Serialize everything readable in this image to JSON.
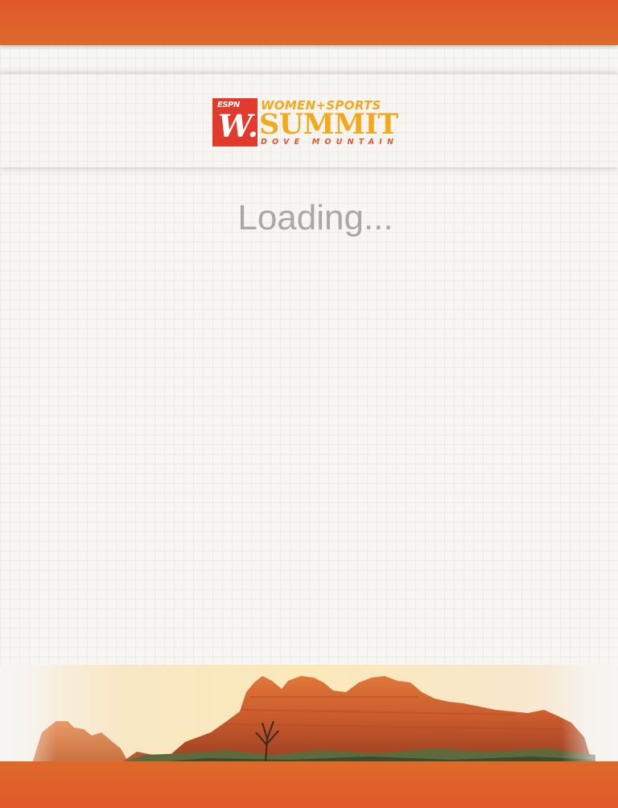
{
  "app": {
    "loading_text": "Loading..."
  },
  "logo": {
    "brand": "ESPN",
    "mark": "W.",
    "line1": "WOMEN+SPORTS",
    "line2": "SUMMIT",
    "line3": "DOVE MOUNTAIN"
  },
  "colors": {
    "header_orange": "#e2582a",
    "logo_gold": "#f2a91c",
    "logo_red": "#e23b2e",
    "loading_gray": "#a8a8a8"
  },
  "scenery": {
    "subject": "red rock mountain landscape"
  }
}
